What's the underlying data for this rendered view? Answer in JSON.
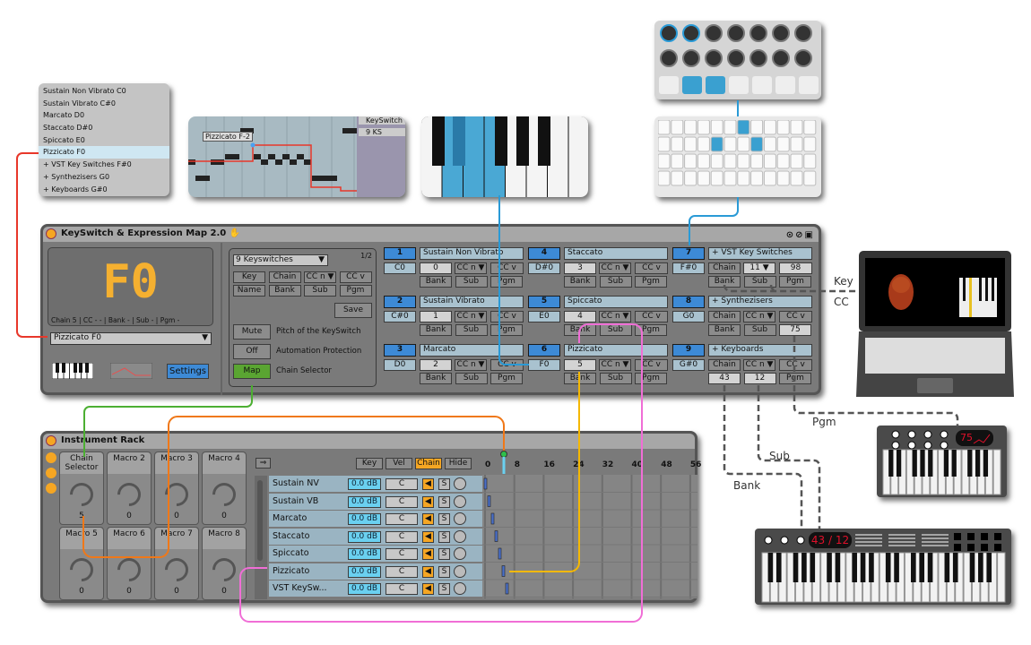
{
  "keyswitch_list": {
    "items": [
      "Sustain Non Vibrato C0",
      "Sustain Vibrato C#0",
      "Marcato D0",
      "Staccato D#0",
      "Spiccato E0",
      "Pizzicato F0",
      "+ VST Key Switches F#0",
      "+ Synthezisers G0",
      "+ Keyboards G#0"
    ],
    "selected_index": 5
  },
  "piano_roll": {
    "note_label": "Pizzicato F-2",
    "tracks": [
      "KeySwitch",
      "9 KS"
    ]
  },
  "device": {
    "title": "KeySwitch & Expression Map 2.0",
    "display_note": "F0",
    "display_status": "Chain 5 | CC - - | Bank - | Sub - | Pgm -",
    "selected": "Pizzicato F0",
    "settings": "Settings",
    "preset": "9 Keyswitches",
    "page": "1/2",
    "header_buttons": [
      "Key",
      "Chain",
      "CC n ▼",
      "CC v",
      "Name",
      "Bank",
      "Sub",
      "Pgm"
    ],
    "save": "Save",
    "options": [
      {
        "button": "Mute",
        "label": "Pitch of the KeySwitch"
      },
      {
        "button": "Off",
        "label": "Automation Protection"
      },
      {
        "button": "Map",
        "label": "Chain Selector"
      }
    ],
    "slots": [
      {
        "num": "1",
        "name": "Sustain Non Vibrato",
        "key": "C0",
        "chain": "0",
        "ccn": "CC n ▼",
        "ccv": "CC v",
        "bank": "Bank",
        "sub": "Sub",
        "pgm": "Pgm"
      },
      {
        "num": "2",
        "name": "Sustain Vibrato",
        "key": "C#0",
        "chain": "1",
        "ccn": "CC n ▼",
        "ccv": "CC v",
        "bank": "Bank",
        "sub": "Sub",
        "pgm": "Pgm"
      },
      {
        "num": "3",
        "name": "Marcato",
        "key": "D0",
        "chain": "2",
        "ccn": "CC n ▼",
        "ccv": "CC v",
        "bank": "Bank",
        "sub": "Sub",
        "pgm": "Pgm"
      },
      {
        "num": "4",
        "name": "Staccato",
        "key": "D#0",
        "chain": "3",
        "ccn": "CC n ▼",
        "ccv": "CC v",
        "bank": "Bank",
        "sub": "Sub",
        "pgm": "Pgm"
      },
      {
        "num": "5",
        "name": "Spiccato",
        "key": "E0",
        "chain": "4",
        "ccn": "CC n ▼",
        "ccv": "CC v",
        "bank": "Bank",
        "sub": "Sub",
        "pgm": "Pgm"
      },
      {
        "num": "6",
        "name": "Pizzicato",
        "key": "F0",
        "chain": "5",
        "ccn": "CC n ▼",
        "ccv": "CC v",
        "bank": "Bank",
        "sub": "Sub",
        "pgm": "Pgm"
      },
      {
        "num": "7",
        "name": "+ VST Key Switches",
        "key": "F#0",
        "chain": "Chain",
        "ccn": "11 ▼",
        "ccv": "98",
        "bank": "Bank",
        "sub": "Sub",
        "pgm": "Pgm"
      },
      {
        "num": "8",
        "name": "+ Synthezisers",
        "key": "G0",
        "chain": "Chain",
        "ccn": "CC n ▼",
        "ccv": "CC v",
        "bank": "Bank",
        "sub": "Sub",
        "pgm": "75"
      },
      {
        "num": "9",
        "name": "+ Keyboards",
        "key": "G#0",
        "chain": "Chain",
        "ccn": "CC n ▼",
        "ccv": "CC v",
        "bank": "43",
        "sub": "12",
        "pgm": "Pgm"
      }
    ]
  },
  "rack": {
    "title": "Instrument Rack",
    "macros": [
      {
        "name": "Chain Selector",
        "value": "5"
      },
      {
        "name": "Macro 2",
        "value": "0"
      },
      {
        "name": "Macro 3",
        "value": "0"
      },
      {
        "name": "Macro 4",
        "value": "0"
      },
      {
        "name": "Macro 5",
        "value": "0"
      },
      {
        "name": "Macro 6",
        "value": "0"
      },
      {
        "name": "Macro 7",
        "value": "0"
      },
      {
        "name": "Macro 8",
        "value": "0"
      }
    ],
    "view_buttons": [
      "Key",
      "Vel",
      "Chain",
      "Hide"
    ],
    "chains": [
      {
        "name": "Sustain NV",
        "vol": "0.0 dB",
        "pan": "C",
        "solo": "S"
      },
      {
        "name": "Sustain VB",
        "vol": "0.0 dB",
        "pan": "C",
        "solo": "S"
      },
      {
        "name": "Marcato",
        "vol": "0.0 dB",
        "pan": "C",
        "solo": "S"
      },
      {
        "name": "Staccato",
        "vol": "0.0 dB",
        "pan": "C",
        "solo": "S"
      },
      {
        "name": "Spiccato",
        "vol": "0.0 dB",
        "pan": "C",
        "solo": "S"
      },
      {
        "name": "Pizzicato",
        "vol": "0.0 dB",
        "pan": "C",
        "solo": "S"
      },
      {
        "name": "VST KeySw...",
        "vol": "0.0 dB",
        "pan": "C",
        "solo": "S"
      }
    ],
    "ruler": [
      "0",
      "8",
      "16",
      "24",
      "32",
      "40",
      "48",
      "56"
    ],
    "selector_value": 5
  },
  "annotations": {
    "key": "Key",
    "cc": "CC",
    "pgm": "Pgm",
    "sub": "Sub",
    "bank": "Bank"
  },
  "hardware": {
    "synth_display": "75",
    "keyboard_display": "43 / 12"
  },
  "colors": {
    "accent_blue": "#3d8ad6",
    "orange": "#f5a623",
    "map_green": "#5aa532",
    "line_red": "#e8372a",
    "line_blue": "#2a9ad6",
    "line_green": "#4caf32",
    "line_orange": "#f07818",
    "line_pink": "#f06ed6",
    "line_yellow": "#f5b800"
  }
}
